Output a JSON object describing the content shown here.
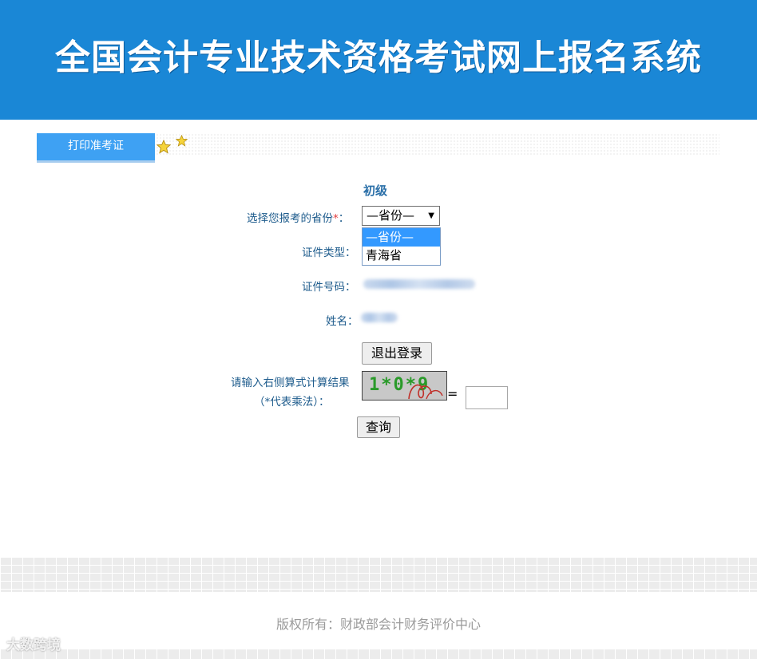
{
  "header": {
    "title": "全国会计专业技术资格考试网上报名系统"
  },
  "tabs": [
    {
      "label": "打印准考证"
    }
  ],
  "form": {
    "level": "初级",
    "province_label": "选择您报考的省份",
    "required_mark": "*",
    "colon": "：",
    "province_select": {
      "value": "—省份—",
      "options": [
        "—省份—",
        "青海省"
      ],
      "highlighted": "—省份—"
    },
    "id_type_label": "证件类型：",
    "id_number_label": "证件号码：",
    "name_label": "姓名：",
    "logout_button": "退出登录",
    "captcha_label_line1": "请输入右侧算式计算结果",
    "captcha_label_line2": "（*代表乘法）：",
    "captcha_text": "1*0*9",
    "equals": "=",
    "answer_value": "",
    "query_button": "查询"
  },
  "footer": {
    "copyright": "版权所有：财政部会计财务评价中心"
  },
  "watermark": "大数跨境",
  "colors": {
    "banner": "#1a87d6",
    "tab": "#3ea1f3",
    "option_highlight": "#3399ff",
    "required": "#e23c3c"
  }
}
